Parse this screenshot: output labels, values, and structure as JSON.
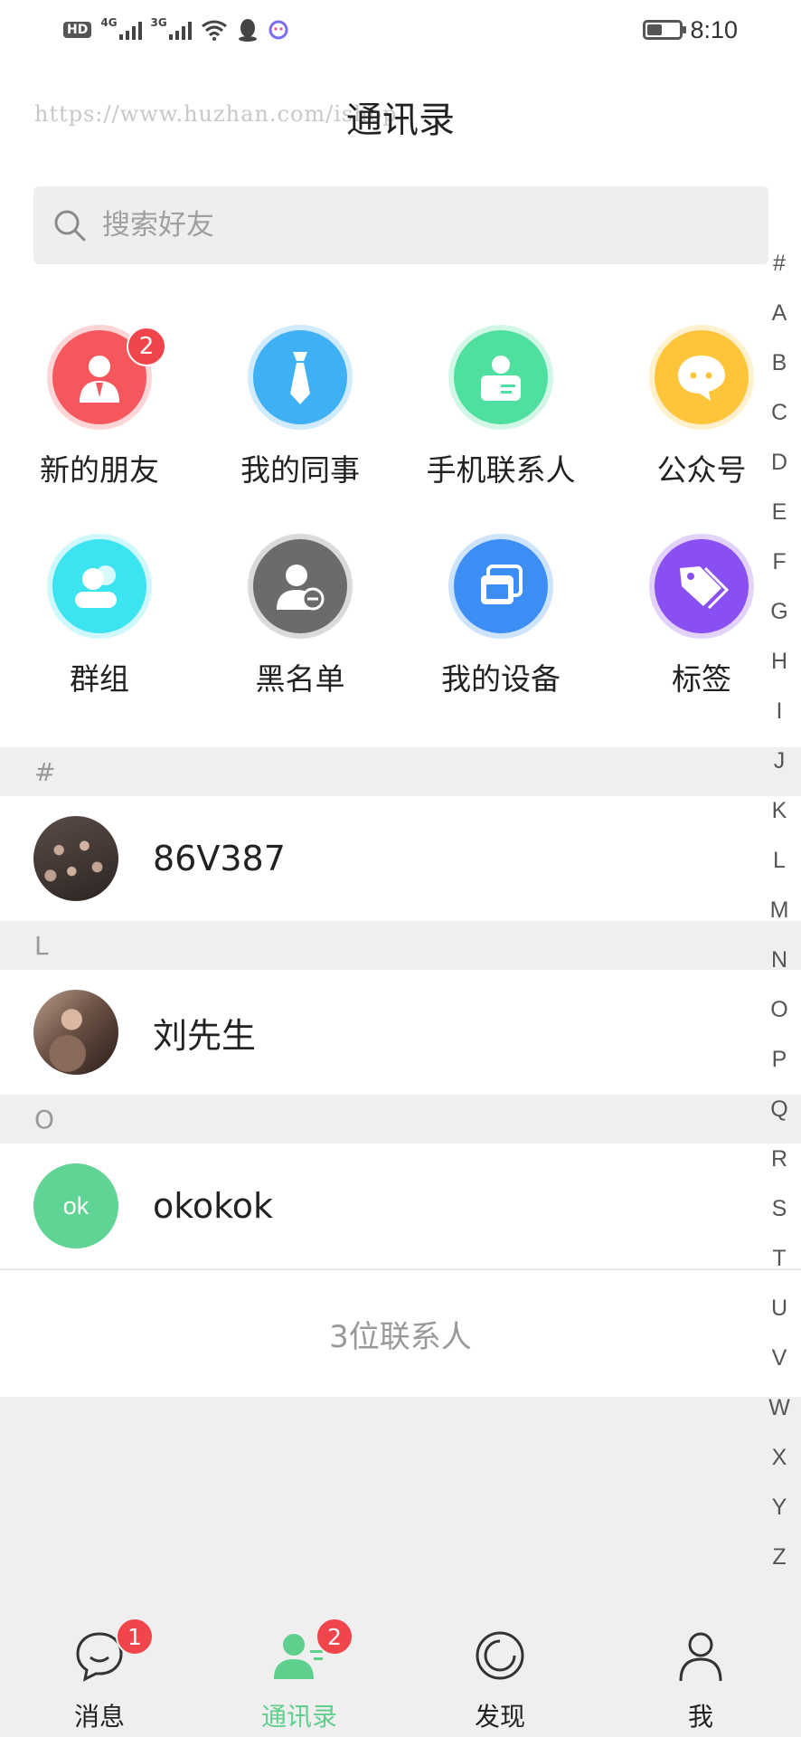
{
  "status_bar": {
    "hd": "HD",
    "net1": "4G",
    "net2": "3G",
    "time": "8:10"
  },
  "header": {
    "watermark": "https://www.huzhan.com/ishop",
    "title": "通讯录"
  },
  "search": {
    "placeholder": "搜索好友"
  },
  "features": [
    {
      "label": "新的朋友",
      "icon": "new-friend-icon",
      "color": "#f6575c",
      "badge": "2"
    },
    {
      "label": "我的同事",
      "icon": "tie-icon",
      "color": "#3fb0f5"
    },
    {
      "label": "手机联系人",
      "icon": "phone-contact-icon",
      "color": "#4fe0a0"
    },
    {
      "label": "公众号",
      "icon": "chat-bubble-icon",
      "color": "#fec43a"
    },
    {
      "label": "群组",
      "icon": "group-icon",
      "color": "#3de3f0"
    },
    {
      "label": "黑名单",
      "icon": "blacklist-icon",
      "color": "#6b6b6b"
    },
    {
      "label": "我的设备",
      "icon": "device-icon",
      "color": "#3c8ef5"
    },
    {
      "label": "标签",
      "icon": "tag-icon",
      "color": "#8a4ff2"
    }
  ],
  "sections": [
    {
      "letter": "#",
      "contacts": [
        {
          "name": "86V387",
          "avatar": "photo"
        }
      ]
    },
    {
      "letter": "L",
      "contacts": [
        {
          "name": "刘先生",
          "avatar": "photo"
        }
      ]
    },
    {
      "letter": "O",
      "contacts": [
        {
          "name": "okokok",
          "avatar_text": "ok",
          "avatar_color": "#5fd494"
        }
      ]
    }
  ],
  "contact_count": "3位联系人",
  "alphabet": [
    "#",
    "A",
    "B",
    "C",
    "D",
    "E",
    "F",
    "G",
    "H",
    "I",
    "J",
    "K",
    "L",
    "M",
    "N",
    "O",
    "P",
    "Q",
    "R",
    "S",
    "T",
    "U",
    "V",
    "W",
    "X",
    "Y",
    "Z"
  ],
  "tabs": [
    {
      "label": "消息",
      "icon": "message-icon",
      "badge": "1",
      "active": false
    },
    {
      "label": "通讯录",
      "icon": "contacts-icon",
      "badge": "2",
      "active": true
    },
    {
      "label": "发现",
      "icon": "discover-icon",
      "active": false
    },
    {
      "label": "我",
      "icon": "profile-icon",
      "active": false
    }
  ],
  "colors": {
    "accent": "#5fcf8d",
    "badge": "#f0454b"
  }
}
